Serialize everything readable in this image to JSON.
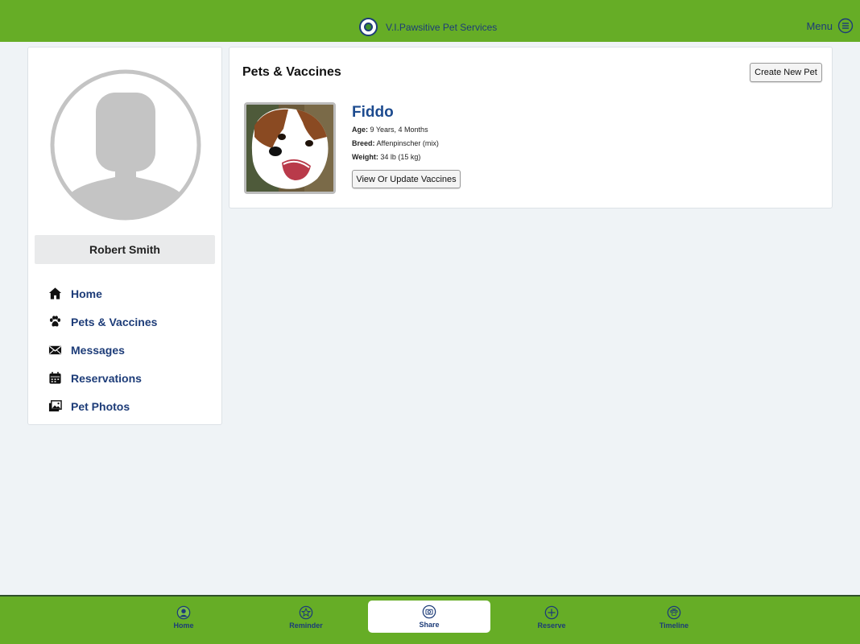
{
  "header": {
    "title": "V.I.Pawsitive Pet Services",
    "logo_icon": "paw-logo-icon",
    "menu_label": "Menu",
    "brand_color": "#66ad26",
    "text_color": "#1d3c78"
  },
  "sidebar": {
    "user_name": "Robert Smith",
    "items": [
      {
        "label": "Home",
        "icon": "home-icon"
      },
      {
        "label": "Pets & Vaccines",
        "icon": "paw-icon"
      },
      {
        "label": "Messages",
        "icon": "envelope-icon"
      },
      {
        "label": "Reservations",
        "icon": "calendar-icon"
      },
      {
        "label": "Pet Photos",
        "icon": "photos-icon"
      }
    ]
  },
  "main": {
    "title": "Pets & Vaccines",
    "create_button": "Create New Pet",
    "pet": {
      "name": "Fiddo",
      "age_label": "Age:",
      "age_value": "9 Years, 4 Months",
      "breed_label": "Breed:",
      "breed_value": "Affenpinscher (mix)",
      "weight_label": "Weight:",
      "weight_value": "34 lb (15 kg)",
      "vaccines_button": "View Or Update Vaccines"
    }
  },
  "bottom_nav": {
    "active": "Share",
    "tabs": [
      {
        "label": "Home",
        "icon": "user-circle-icon"
      },
      {
        "label": "Reminder",
        "icon": "star-icon"
      },
      {
        "label": "Share",
        "icon": "camera-icon"
      },
      {
        "label": "Reserve",
        "icon": "plus-circle-icon"
      },
      {
        "label": "Timeline",
        "icon": "paw-circle-icon"
      }
    ]
  }
}
